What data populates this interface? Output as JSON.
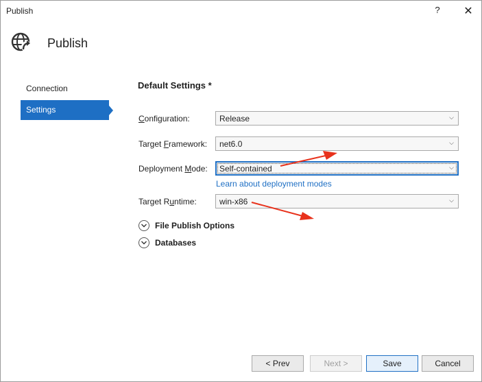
{
  "window": {
    "title": "Publish",
    "help": "?",
    "close": "✕"
  },
  "header": {
    "title": "Publish",
    "icon": "globe-publish-icon"
  },
  "nav": {
    "items": [
      {
        "label": "Connection",
        "active": false
      },
      {
        "label": "Settings",
        "active": true
      }
    ]
  },
  "settings": {
    "section_title": "Default Settings *",
    "configuration": {
      "label_pre": "",
      "label_key": "C",
      "label_post": "onfiguration:",
      "value": "Release"
    },
    "framework": {
      "label_pre": "Target ",
      "label_key": "F",
      "label_post": "ramework:",
      "value": "net6.0"
    },
    "deployment": {
      "label_pre": "Deployment ",
      "label_key": "M",
      "label_post": "ode:",
      "value": "Self-contained"
    },
    "learn_link": "Learn about deployment modes",
    "runtime": {
      "label_pre": "Target R",
      "label_key": "u",
      "label_post": "ntime:",
      "value": "win-x86"
    }
  },
  "expanders": {
    "file_publish": "File Publish Options",
    "databases": "Databases"
  },
  "buttons": {
    "prev": "< Prev",
    "next": "Next >",
    "save": "Save",
    "cancel": "Cancel"
  },
  "colors": {
    "accent": "#1e6fc4",
    "annotation_arrow": "#e8321c"
  }
}
